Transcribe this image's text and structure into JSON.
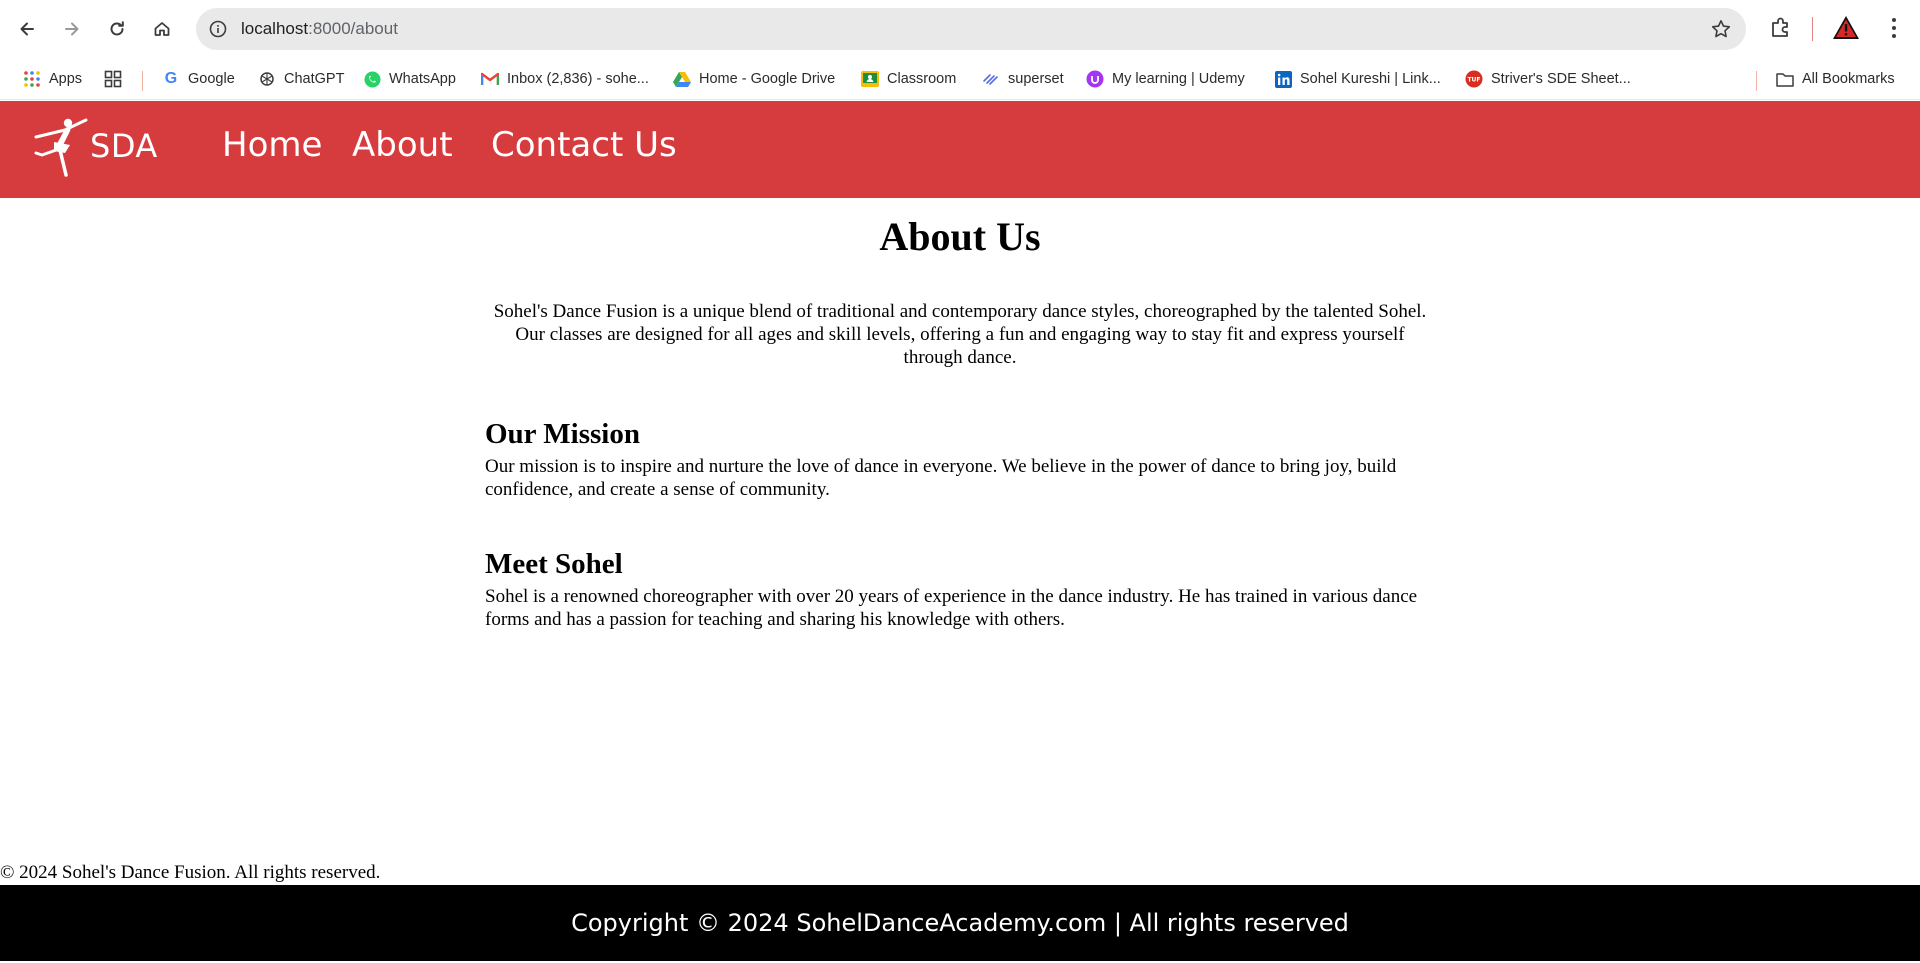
{
  "browser": {
    "url_host": "localhost",
    "url_rest": ":8000/about",
    "bookmarks": [
      {
        "label": "Apps",
        "icon": "apps-grid-icon"
      },
      {
        "label": "Google",
        "icon": "google-icon"
      },
      {
        "label": "ChatGPT",
        "icon": "chatgpt-icon"
      },
      {
        "label": "WhatsApp",
        "icon": "whatsapp-icon"
      },
      {
        "label": "Inbox (2,836) - sohe...",
        "icon": "gmail-icon"
      },
      {
        "label": "Home - Google Drive",
        "icon": "google-drive-icon"
      },
      {
        "label": "Classroom",
        "icon": "classroom-icon"
      },
      {
        "label": "superset",
        "icon": "superset-icon"
      },
      {
        "label": "My learning | Udemy",
        "icon": "udemy-icon"
      },
      {
        "label": "Sohel Kureshi | Link...",
        "icon": "linkedin-icon"
      },
      {
        "label": "Striver's SDE Sheet...",
        "icon": "tuf-icon"
      }
    ],
    "all_bookmarks": "All Bookmarks"
  },
  "header": {
    "brand": "SDA",
    "nav": [
      "Home",
      "About",
      "Contact Us"
    ]
  },
  "main": {
    "title": "About Us",
    "intro": "Sohel's Dance Fusion is a unique blend of traditional and contemporary dance styles, choreographed by the talented Sohel. Our classes are designed for all ages and skill levels, offering a fun and engaging way to stay fit and express yourself through dance.",
    "sections": [
      {
        "heading": "Our Mission",
        "text": "Our mission is to inspire and nurture the love of dance in everyone. We believe in the power of dance to bring joy, build confidence, and create a sense of community."
      },
      {
        "heading": "Meet Sohel",
        "text": "Sohel is a renowned choreographer with over 20 years of experience in the dance industry. He has trained in various dance forms and has a passion for teaching and sharing his knowledge with others."
      }
    ]
  },
  "footer": {
    "copyright_text": "© 2024 Sohel's Dance Fusion. All rights reserved.",
    "bar_text": "Copyright © 2024 SohelDanceAcademy.com | All rights reserved"
  },
  "colors": {
    "header_red": "#d63b3e",
    "footer_black": "#000000"
  }
}
